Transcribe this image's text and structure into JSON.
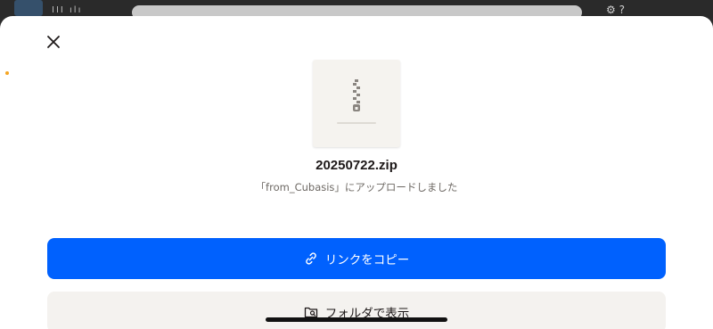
{
  "background_app": {
    "toolbar_glyphs_left": "III ılı",
    "toolbar_glyphs_right": "⚙ ? "
  },
  "sheet": {
    "close_icon": "close-icon",
    "file": {
      "name": "20250722.zip",
      "subtitle": "「from_Cubasis」にアップロードしました",
      "icon": "zip-file-icon"
    },
    "primary_button": {
      "label": "リンクをコピー",
      "icon": "link-icon",
      "color": "#0061fe"
    },
    "secondary_button": {
      "label": "フォルダで表示",
      "icon": "folder-search-icon",
      "color": "#f4f2ef"
    }
  }
}
